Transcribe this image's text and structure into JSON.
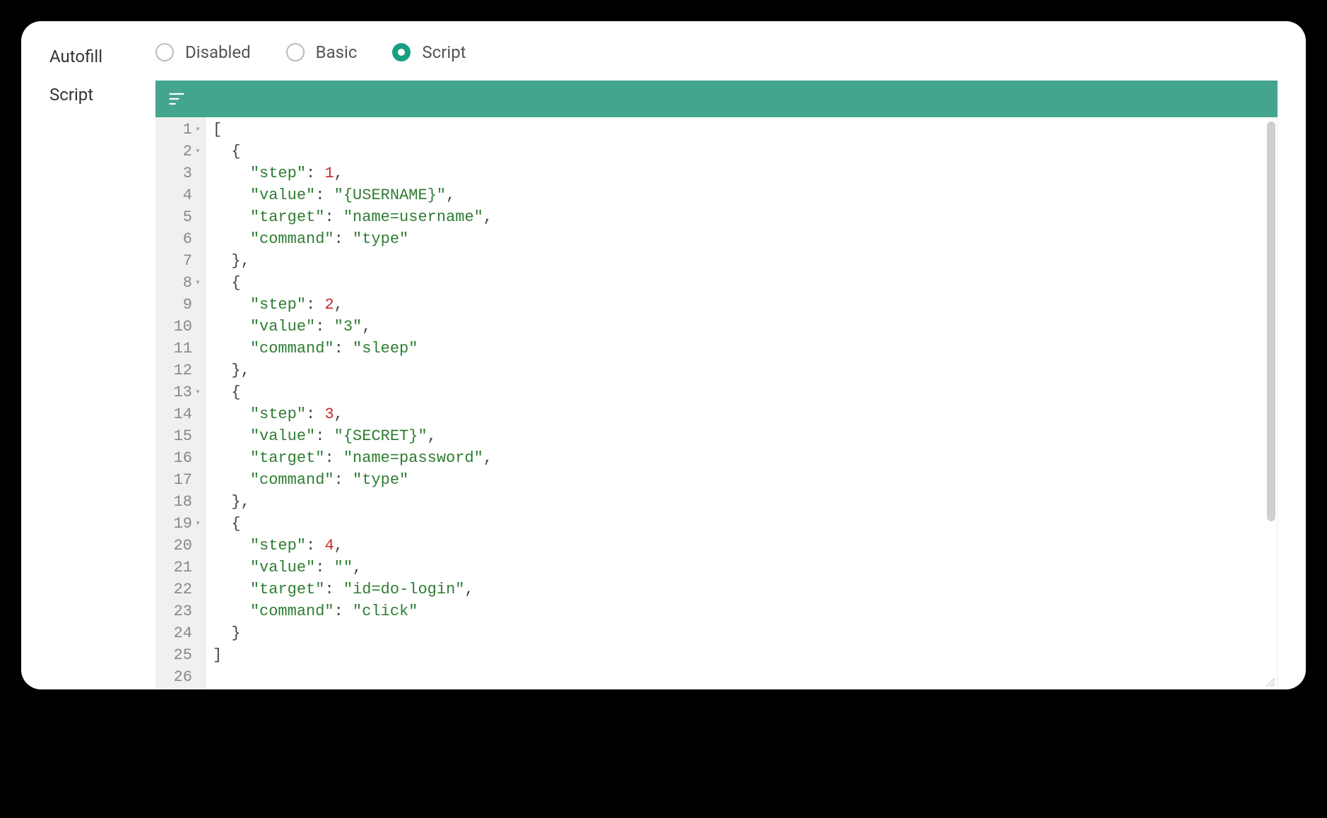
{
  "labels": {
    "autofill": "Autofill",
    "script": "Script"
  },
  "radios": {
    "disabled": "Disabled",
    "basic": "Basic",
    "script": "Script",
    "selected": "script"
  },
  "colors": {
    "accent": "#44a58e",
    "radio_selected": "#1a9e82"
  },
  "editor": {
    "lines": [
      {
        "n": 1,
        "fold": true,
        "indent": 0,
        "tokens": [
          [
            "punc",
            "["
          ]
        ]
      },
      {
        "n": 2,
        "fold": true,
        "indent": 1,
        "tokens": [
          [
            "punc",
            "{"
          ]
        ]
      },
      {
        "n": 3,
        "fold": false,
        "indent": 2,
        "tokens": [
          [
            "key",
            "\"step\""
          ],
          [
            "punc",
            ": "
          ],
          [
            "num",
            "1"
          ],
          [
            "punc",
            ","
          ]
        ]
      },
      {
        "n": 4,
        "fold": false,
        "indent": 2,
        "tokens": [
          [
            "key",
            "\"value\""
          ],
          [
            "punc",
            ": "
          ],
          [
            "str",
            "\"{USERNAME}\""
          ],
          [
            "punc",
            ","
          ]
        ]
      },
      {
        "n": 5,
        "fold": false,
        "indent": 2,
        "tokens": [
          [
            "key",
            "\"target\""
          ],
          [
            "punc",
            ": "
          ],
          [
            "str",
            "\"name=username\""
          ],
          [
            "punc",
            ","
          ]
        ]
      },
      {
        "n": 6,
        "fold": false,
        "indent": 2,
        "tokens": [
          [
            "key",
            "\"command\""
          ],
          [
            "punc",
            ": "
          ],
          [
            "str",
            "\"type\""
          ]
        ]
      },
      {
        "n": 7,
        "fold": false,
        "indent": 1,
        "tokens": [
          [
            "punc",
            "},"
          ]
        ]
      },
      {
        "n": 8,
        "fold": true,
        "indent": 1,
        "tokens": [
          [
            "punc",
            "{"
          ]
        ]
      },
      {
        "n": 9,
        "fold": false,
        "indent": 2,
        "tokens": [
          [
            "key",
            "\"step\""
          ],
          [
            "punc",
            ": "
          ],
          [
            "num",
            "2"
          ],
          [
            "punc",
            ","
          ]
        ]
      },
      {
        "n": 10,
        "fold": false,
        "indent": 2,
        "tokens": [
          [
            "key",
            "\"value\""
          ],
          [
            "punc",
            ": "
          ],
          [
            "str",
            "\"3\""
          ],
          [
            "punc",
            ","
          ]
        ]
      },
      {
        "n": 11,
        "fold": false,
        "indent": 2,
        "tokens": [
          [
            "key",
            "\"command\""
          ],
          [
            "punc",
            ": "
          ],
          [
            "str",
            "\"sleep\""
          ]
        ]
      },
      {
        "n": 12,
        "fold": false,
        "indent": 1,
        "tokens": [
          [
            "punc",
            "},"
          ]
        ]
      },
      {
        "n": 13,
        "fold": true,
        "indent": 1,
        "tokens": [
          [
            "punc",
            "{"
          ]
        ]
      },
      {
        "n": 14,
        "fold": false,
        "indent": 2,
        "tokens": [
          [
            "key",
            "\"step\""
          ],
          [
            "punc",
            ": "
          ],
          [
            "num",
            "3"
          ],
          [
            "punc",
            ","
          ]
        ]
      },
      {
        "n": 15,
        "fold": false,
        "indent": 2,
        "tokens": [
          [
            "key",
            "\"value\""
          ],
          [
            "punc",
            ": "
          ],
          [
            "str",
            "\"{SECRET}\""
          ],
          [
            "punc",
            ","
          ]
        ]
      },
      {
        "n": 16,
        "fold": false,
        "indent": 2,
        "tokens": [
          [
            "key",
            "\"target\""
          ],
          [
            "punc",
            ": "
          ],
          [
            "str",
            "\"name=password\""
          ],
          [
            "punc",
            ","
          ]
        ]
      },
      {
        "n": 17,
        "fold": false,
        "indent": 2,
        "tokens": [
          [
            "key",
            "\"command\""
          ],
          [
            "punc",
            ": "
          ],
          [
            "str",
            "\"type\""
          ]
        ]
      },
      {
        "n": 18,
        "fold": false,
        "indent": 1,
        "tokens": [
          [
            "punc",
            "},"
          ]
        ]
      },
      {
        "n": 19,
        "fold": true,
        "indent": 1,
        "tokens": [
          [
            "punc",
            "{"
          ]
        ]
      },
      {
        "n": 20,
        "fold": false,
        "indent": 2,
        "tokens": [
          [
            "key",
            "\"step\""
          ],
          [
            "punc",
            ": "
          ],
          [
            "num",
            "4"
          ],
          [
            "punc",
            ","
          ]
        ]
      },
      {
        "n": 21,
        "fold": false,
        "indent": 2,
        "tokens": [
          [
            "key",
            "\"value\""
          ],
          [
            "punc",
            ": "
          ],
          [
            "str",
            "\"\""
          ],
          [
            "punc",
            ","
          ]
        ]
      },
      {
        "n": 22,
        "fold": false,
        "indent": 2,
        "tokens": [
          [
            "key",
            "\"target\""
          ],
          [
            "punc",
            ": "
          ],
          [
            "str",
            "\"id=do-login\""
          ],
          [
            "punc",
            ","
          ]
        ]
      },
      {
        "n": 23,
        "fold": false,
        "indent": 2,
        "tokens": [
          [
            "key",
            "\"command\""
          ],
          [
            "punc",
            ": "
          ],
          [
            "str",
            "\"click\""
          ]
        ]
      },
      {
        "n": 24,
        "fold": false,
        "indent": 1,
        "tokens": [
          [
            "punc",
            "}"
          ]
        ]
      },
      {
        "n": 25,
        "fold": false,
        "indent": 0,
        "tokens": [
          [
            "punc",
            "]"
          ]
        ]
      },
      {
        "n": 26,
        "fold": false,
        "indent": 0,
        "tokens": []
      }
    ]
  }
}
